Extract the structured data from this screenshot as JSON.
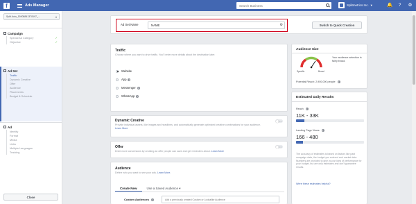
{
  "topbar": {
    "app_title": "Ads Manager",
    "search_placeholder": "Search Business",
    "account_name": "Splitmetrics Inc."
  },
  "sidebar": {
    "account_select": "Split Auto_15908841378197_…",
    "campaign": {
      "title": "Campaign",
      "items": [
        "Special Ad Category",
        "Objective"
      ]
    },
    "adset": {
      "title": "Ad Set",
      "items": [
        "Traffic",
        "Dynamic Creative",
        "Offer",
        "Audience",
        "Placements",
        "Budget & Schedule"
      ]
    },
    "ad": {
      "title": "Ad",
      "items": [
        "Identity",
        "Format",
        "Media",
        "Links",
        "Multiple Languages",
        "Tracking"
      ]
    },
    "close_label": "Close"
  },
  "adset_name": {
    "label": "Ad Set Name",
    "value": "NAME",
    "quick_creation_label": "Switch to Quick Creation"
  },
  "traffic": {
    "title": "Traffic",
    "description": "Choose where you want to drive traffic. You'll enter more details about the destination later.",
    "options": [
      "Website",
      "App",
      "Messenger",
      "WhatsApp"
    ],
    "selected": "Website"
  },
  "dynamic_creative": {
    "title": "Dynamic Creative",
    "description": "Provide individual assets, like images and headlines, and automatically generate optimized creative combinations for your audience.",
    "link": "Learn More",
    "toggle": "OFF"
  },
  "offer": {
    "title": "Offer",
    "description": "Drive more conversions by creating an offer people can save and get reminders about.",
    "link": "Learn More",
    "toggle": "OFF"
  },
  "audience": {
    "title": "Audience",
    "description": "Define who you want to see your ads.",
    "link": "Learn More.",
    "tabs": [
      "Create New",
      "Use a Saved Audience ▾"
    ],
    "custom_label": "Custom Audiences",
    "custom_placeholder": "Add a previously created Custom or Lookalike Audience"
  },
  "audience_size": {
    "title": "Audience Size",
    "gauge_low": "Specific",
    "gauge_high": "Broad",
    "note": "Your audience selection is fairly broad.",
    "reach": "Potential Reach: 2,900,000 people"
  },
  "estimated": {
    "title": "Estimated Daily Results",
    "reach_label": "Reach",
    "reach_value": "11K - 33K",
    "reach_fill": 0.12,
    "lpv_label": "Landing Page Views",
    "lpv_value": "166 - 480",
    "lpv_fill": 0.1,
    "note": "The accuracy of estimates is based on factors like past campaign data, the budget you entered and market data. Numbers are provided to give you an idea of performance for your budget, but are only estimates and don't guarantee results.",
    "helpful_link": "Were these estimates helpful?"
  },
  "colors": {
    "brand": "#4267b2",
    "highlight": "#d0021b"
  }
}
